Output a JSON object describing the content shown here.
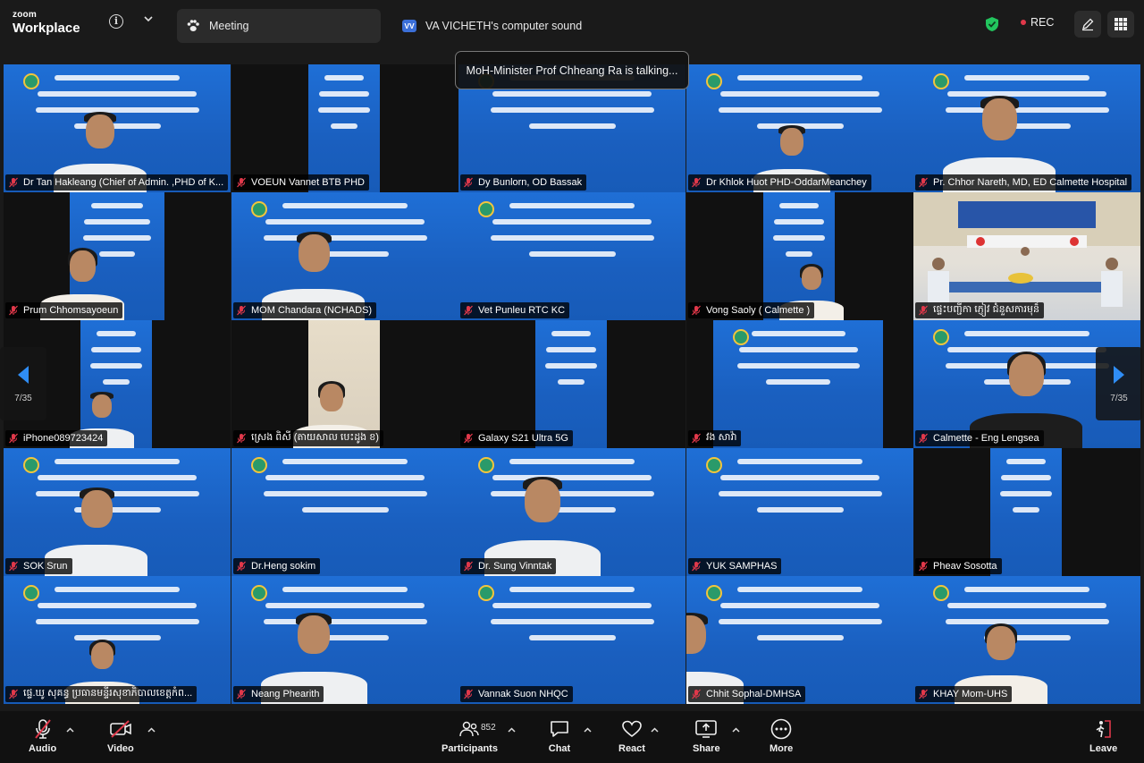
{
  "app": {
    "logo_line1": "zoom",
    "logo_line2": "Workplace"
  },
  "tabs": [
    {
      "label": "Meeting",
      "icon": "paw-icon"
    },
    {
      "label": "VA VICHETH's computer sound",
      "badge": "VV"
    }
  ],
  "recording": {
    "label": "REC"
  },
  "talking_banner": "MoH-Minister Prof Chheang Ra is talking...",
  "pager": {
    "left": "7/35",
    "right": "7/35"
  },
  "participants": [
    {
      "name": "Dr Tan Hakleang (Chief of Admin. ,PHD of  K..."
    },
    {
      "name": "VOEUN Vannet BTB PHD"
    },
    {
      "name": "Dy Bunlorn, OD Bassak"
    },
    {
      "name": "Dr Khlok Huot PHD-OddarMeanchey"
    },
    {
      "name": "Pr. Chhor Nareth, MD, ED Calmette Hospital"
    },
    {
      "name": "Prum Chhomsayoeun"
    },
    {
      "name": "MOM Chandara (NCHADS)"
    },
    {
      "name": "Vet Punleu RTC KC"
    },
    {
      "name": "Vong Saoly ( Calmette )"
    },
    {
      "name": "ផ្ទេះបញ្ជីកា ភ្ញៀវ ជំនួសការមុន៏"
    },
    {
      "name": "iPhone089723424"
    },
    {
      "name": "ស្រេង ពិសី (តាយសាល បេះដូង ខ)"
    },
    {
      "name": "Galaxy S21 Ultra 5G"
    },
    {
      "name": "វង សាវ៉ា"
    },
    {
      "name": "Calmette - Eng Lengsea"
    },
    {
      "name": "SOK Srun"
    },
    {
      "name": "Dr.Heng sokim"
    },
    {
      "name": "Dr. Sung Vinntak"
    },
    {
      "name": "YUK SAMPHAS"
    },
    {
      "name": "Pheav Sosotta"
    },
    {
      "name": "ផ្ទេ.ឃូ សុគន្ធ ប្រធានមន្ទីរសុខាភិបាលខេត្តកំព..."
    },
    {
      "name": "Neang Phearith"
    },
    {
      "name": "Vannak Suon NHQC"
    },
    {
      "name": "Chhit Sophal-DMHSA"
    },
    {
      "name": "KHAY Mom-UHS"
    }
  ],
  "toolbar": {
    "audio": "Audio",
    "video": "Video",
    "participants": "Participants",
    "participants_count": "852",
    "chat": "Chat",
    "react": "React",
    "share": "Share",
    "more": "More",
    "leave": "Leave"
  },
  "colors": {
    "slide_blue": "#1f6fd6",
    "rec_red": "#e0384a",
    "mute_red": "#e0384a",
    "shield_green": "#22c55e"
  }
}
